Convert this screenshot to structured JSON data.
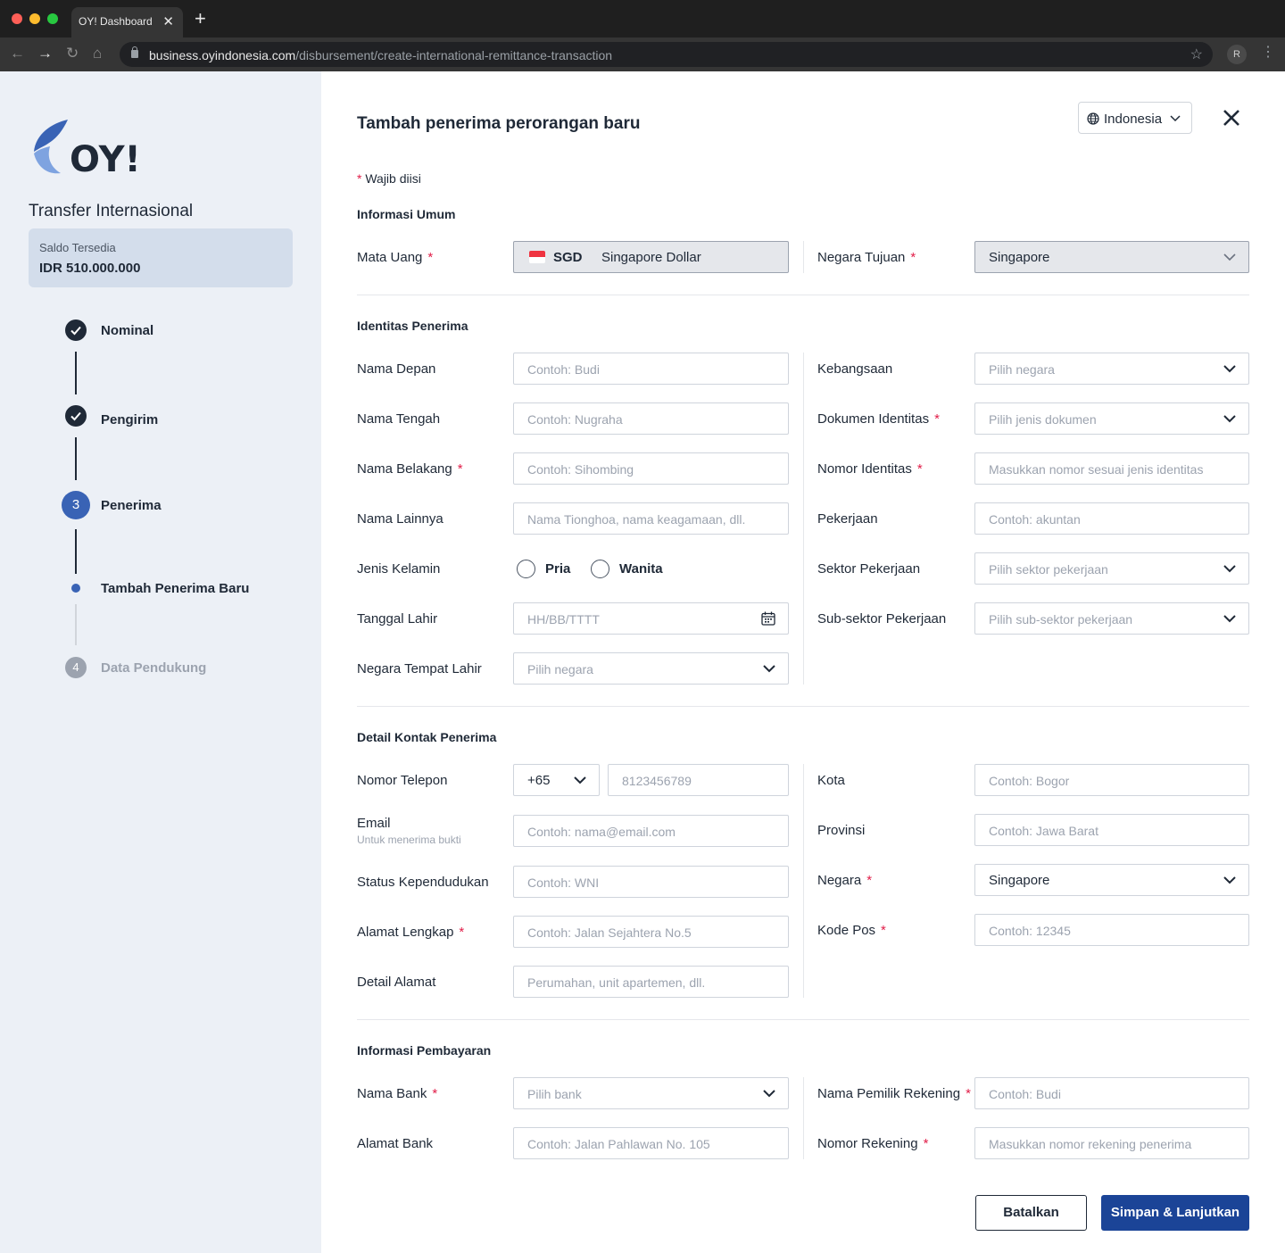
{
  "browser": {
    "tab_title": "OY! Dashboard",
    "url_host": "business.oyindonesia.com",
    "url_path": "/disbursement/create-international-remittance-transaction",
    "profile_initial": "R"
  },
  "sidebar": {
    "title": "Transfer Internasional",
    "balance_label": "Saldo Tersedia",
    "balance_value": "IDR 510.000.000",
    "steps": [
      {
        "label": "Nominal",
        "state": "done"
      },
      {
        "label": "Pengirim",
        "state": "done"
      },
      {
        "label": "Penerima",
        "number": "3",
        "state": "active"
      },
      {
        "label": "Tambah Penerima Baru",
        "state": "sub-active"
      },
      {
        "label": "Data Pendukung",
        "number": "4",
        "state": "pending"
      }
    ]
  },
  "header": {
    "title": "Tambah penerima perorangan baru",
    "language": "Indonesia",
    "required_note": "Wajib diisi"
  },
  "sections": {
    "general": "Informasi Umum",
    "identity": "Identitas Penerima",
    "contact": "Detail Kontak Penerima",
    "payment": "Informasi Pembayaran"
  },
  "general": {
    "currency_label": "Mata Uang",
    "currency_code": "SGD",
    "currency_name": "Singapore Dollar",
    "destination_label": "Negara Tujuan",
    "destination_value": "Singapore"
  },
  "identity": {
    "first_name": {
      "label": "Nama Depan",
      "placeholder": "Contoh: Budi"
    },
    "middle_name": {
      "label": "Nama Tengah",
      "placeholder": "Contoh: Nugraha"
    },
    "last_name": {
      "label": "Nama Belakang",
      "placeholder": "Contoh: Sihombing"
    },
    "other_name": {
      "label": "Nama Lainnya",
      "placeholder": "Nama Tionghoa, nama keagamaan, dll."
    },
    "gender": {
      "label": "Jenis Kelamin",
      "options": [
        "Pria",
        "Wanita"
      ]
    },
    "birth_date": {
      "label": "Tanggal Lahir",
      "placeholder": "HH/BB/TTTT"
    },
    "birth_country": {
      "label": "Negara Tempat Lahir",
      "placeholder": "Pilih negara"
    },
    "nationality": {
      "label": "Kebangsaan",
      "placeholder": "Pilih negara"
    },
    "id_document": {
      "label": "Dokumen Identitas",
      "placeholder": "Pilih jenis dokumen"
    },
    "id_number": {
      "label": "Nomor Identitas",
      "placeholder": "Masukkan nomor sesuai jenis identitas"
    },
    "occupation": {
      "label": "Pekerjaan",
      "placeholder": "Contoh: akuntan"
    },
    "sector": {
      "label": "Sektor Pekerjaan",
      "placeholder": "Pilih sektor pekerjaan"
    },
    "sub_sector": {
      "label": "Sub-sektor Pekerjaan",
      "placeholder": "Pilih sub-sektor pekerjaan"
    }
  },
  "contact": {
    "phone": {
      "label": "Nomor Telepon",
      "code": "+65",
      "placeholder": "8123456789"
    },
    "email": {
      "label": "Email",
      "sublabel": "Untuk menerima bukti",
      "placeholder": "Contoh: nama@email.com"
    },
    "residency": {
      "label": "Status Kependudukan",
      "placeholder": "Contoh: WNI"
    },
    "address": {
      "label": "Alamat Lengkap",
      "placeholder": "Contoh: Jalan Sejahtera No.5"
    },
    "address_detail": {
      "label": "Detail Alamat",
      "placeholder": "Perumahan, unit apartemen, dll."
    },
    "city": {
      "label": "Kota",
      "placeholder": "Contoh: Bogor"
    },
    "province": {
      "label": "Provinsi",
      "placeholder": "Contoh: Jawa Barat"
    },
    "country": {
      "label": "Negara",
      "value": "Singapore"
    },
    "postal": {
      "label": "Kode Pos",
      "placeholder": "Contoh: 12345"
    }
  },
  "payment": {
    "bank_name": {
      "label": "Nama Bank",
      "placeholder": "Pilih bank"
    },
    "bank_address": {
      "label": "Alamat Bank",
      "placeholder": "Contoh: Jalan Pahlawan No. 105"
    },
    "account_holder": {
      "label": "Nama Pemilik Rekening",
      "placeholder": "Contoh: Budi"
    },
    "account_number": {
      "label": "Nomor Rekening",
      "placeholder": "Masukkan nomor rekening penerima"
    }
  },
  "actions": {
    "cancel": "Batalkan",
    "save": "Simpan & Lanjutkan"
  },
  "colors": {
    "primary": "#1b4497",
    "step_active": "#3963b5",
    "required": "#e11d48",
    "sidebar_bg": "#ecf0f6"
  },
  "icons": {
    "language": "globe-icon",
    "close": "close-icon",
    "dropdown": "chevron-down-icon",
    "calendar": "calendar-icon",
    "step_done": "check-icon"
  }
}
